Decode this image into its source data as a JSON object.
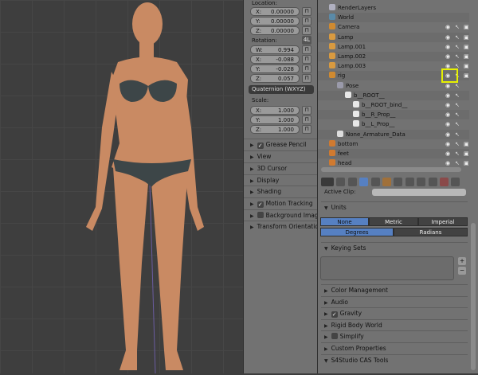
{
  "viewport": {
    "skin_color": "#c98a63",
    "lingerie_color": "#3d4648"
  },
  "transform_panel": {
    "location_label": "Location:",
    "location": [
      {
        "axis": "X:",
        "value": "0.00000"
      },
      {
        "axis": "Y:",
        "value": "0.00000"
      },
      {
        "axis": "Z:",
        "value": "0.00000"
      }
    ],
    "rotation_label": "Rotation:",
    "rotation_lock_label": "4L",
    "rotation": [
      {
        "axis": "W:",
        "value": "0.994"
      },
      {
        "axis": "X:",
        "value": "-0.088"
      },
      {
        "axis": "Y:",
        "value": "-0.028"
      },
      {
        "axis": "Z:",
        "value": "0.057"
      }
    ],
    "rotation_mode": "Quaternion (WXYZ)",
    "scale_label": "Scale:",
    "scale": [
      {
        "axis": "X:",
        "value": "1.000"
      },
      {
        "axis": "Y:",
        "value": "1.000"
      },
      {
        "axis": "Z:",
        "value": "1.000"
      }
    ],
    "panels": [
      {
        "label": "Grease Pencil",
        "checkbox": true,
        "checked": true
      },
      {
        "label": "View"
      },
      {
        "label": "3D Cursor"
      },
      {
        "label": "Display"
      },
      {
        "label": "Shading"
      },
      {
        "label": "Motion Tracking",
        "checkbox": true,
        "checked": true
      },
      {
        "label": "Background Imag",
        "checkbox": true,
        "checked": false
      },
      {
        "label": "Transform Orientation"
      }
    ]
  },
  "outliner": {
    "rows": [
      {
        "label": "RenderLayers",
        "icon": "render-layers-icon",
        "indent": 1
      },
      {
        "label": "World",
        "icon": "world-icon",
        "indent": 1
      },
      {
        "label": "Camera",
        "icon": "camera-icon",
        "indent": 1
      },
      {
        "label": "Lamp",
        "icon": "lamp-icon",
        "indent": 1
      },
      {
        "label": "Lamp.001",
        "icon": "lamp-icon",
        "indent": 1
      },
      {
        "label": "Lamp.002",
        "icon": "lamp-icon",
        "indent": 1
      },
      {
        "label": "Lamp.003",
        "icon": "lamp-icon",
        "indent": 1
      },
      {
        "label": "rig",
        "icon": "armature-icon",
        "indent": 1
      },
      {
        "label": "Pose",
        "icon": "pose-icon",
        "indent": 2
      },
      {
        "label": "b__ROOT__",
        "icon": "bone-icon",
        "indent": 3
      },
      {
        "label": "b__ROOT_bind__",
        "icon": "bone-icon",
        "indent": 4
      },
      {
        "label": "b__R_Prop__",
        "icon": "bone-icon",
        "indent": 4
      },
      {
        "label": "b__L_Prop__",
        "icon": "bone-icon",
        "indent": 4
      },
      {
        "label": "None_Armature_Data",
        "icon": "armature-data-icon",
        "indent": 2
      },
      {
        "label": "bottom",
        "icon": "mesh-icon",
        "indent": 1
      },
      {
        "label": "feet",
        "icon": "mesh-icon",
        "indent": 1
      },
      {
        "label": "head",
        "icon": "mesh-icon",
        "indent": 1
      }
    ],
    "highlight_color": "#e6f000"
  },
  "properties": {
    "active_clip_label": "Active Clip:",
    "units_header": "Units",
    "unit_systems": [
      "None",
      "Metric",
      "Imperial"
    ],
    "unit_system_selected": "None",
    "rotation_units": [
      "Degrees",
      "Radians"
    ],
    "rotation_units_selected": "Degrees",
    "keying_sets_header": "Keying Sets",
    "accent": "#5680c2",
    "panels": [
      {
        "label": "Color Management"
      },
      {
        "label": "Audio"
      },
      {
        "label": "Gravity",
        "checkbox": true,
        "checked": true
      },
      {
        "label": "Rigid Body World"
      },
      {
        "label": "Simplify",
        "checkbox": true,
        "checked": false
      },
      {
        "label": "Custom Properties"
      },
      {
        "label": "S4Studio CAS Tools",
        "expanded": true
      }
    ]
  }
}
